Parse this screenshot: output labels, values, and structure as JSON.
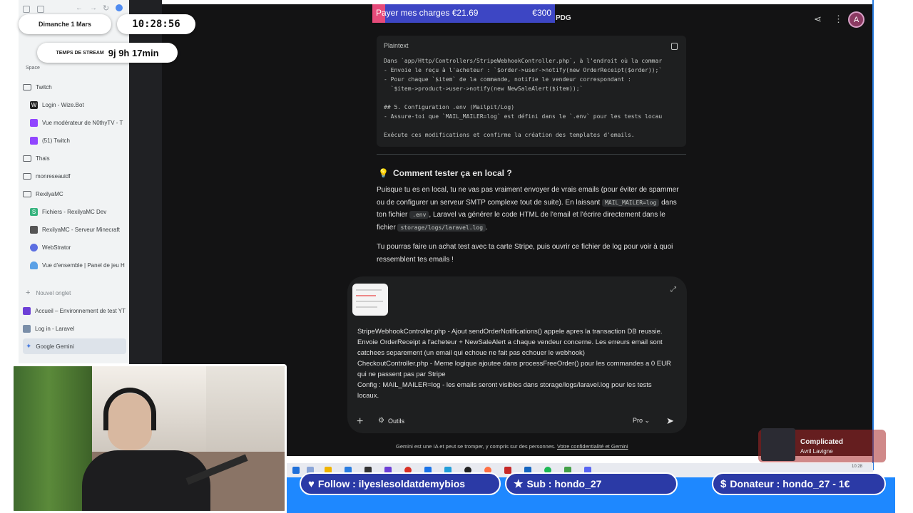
{
  "overlay": {
    "date": "Dimanche 1 Mars",
    "clock": "10:28:56",
    "stream_label": "TEMPS DE STREAM",
    "stream_time": "9j 9h 17min",
    "goal": {
      "label": "Payer mes charges €21.69",
      "target": "€300",
      "progress": 0.07
    },
    "follow": "Follow : ilyeslesoldatdemybios",
    "sub": "Sub : hondo_27",
    "donor": "Donateur : hondo_27 - 1€",
    "music": {
      "title": "Complicated",
      "artist": "Avril Lavigne"
    }
  },
  "sidebar": {
    "space_label": "Space",
    "items": [
      {
        "label": "Twitch",
        "icon": "folder-icon"
      },
      {
        "label": "Login - Wize.Bot",
        "icon": "wizebot-icon"
      },
      {
        "label": "Vue modérateur de N0thyTV - T",
        "icon": "twitch-icon"
      },
      {
        "label": "(51) Twitch",
        "icon": "twitch-icon"
      },
      {
        "label": "Thais",
        "icon": "folder-icon"
      },
      {
        "label": "monreseauidf",
        "icon": "folder-icon"
      },
      {
        "label": "RexilyaMC",
        "icon": "folder-icon"
      },
      {
        "label": "Fichiers - RexilyaMC Dev",
        "icon": "file-icon"
      },
      {
        "label": "RexilyaMC - Serveur Minecraft",
        "icon": "minecraft-icon"
      },
      {
        "label": "WebStrator",
        "icon": "webstrator-icon"
      },
      {
        "label": "Vue d'ensemble | Panel de jeu H",
        "icon": "cloud-icon"
      },
      {
        "label": "Nouvel onglet",
        "icon": "plus-icon"
      },
      {
        "label": "Accueil – Environnement de test YT",
        "icon": "page-icon"
      },
      {
        "label": "Log in - Laravel",
        "icon": "laravel-icon"
      },
      {
        "label": "Google Gemini",
        "icon": "gemini-icon"
      }
    ]
  },
  "gemini": {
    "header_fragment": "PDG",
    "code_lang": "Plaintext",
    "code_lines": [
      "Dans `app/Http/Controllers/StripeWebhookController.php`, à l'endroit où la commar",
      "- Envoie le reçu à l'acheteur : `$order->user->notify(new OrderReceipt($order));`",
      "- Pour chaque `$item` de la commande, notifie le vendeur correspondant :",
      "  `$item->product->user->notify(new NewSaleAlert($item));`",
      "",
      "## 5. Configuration .env (Mailpit/Log)",
      "- Assure-toi que `MAIL_MAILER=log` est défini dans le `.env` pour les tests locau",
      "",
      "Exécute ces modifications et confirme la création des templates d'emails."
    ],
    "heading": "Comment tester ça en local ?",
    "para1": {
      "t1": "Puisque tu es en local, tu ne vas pas vraiment envoyer de vrais emails (pour éviter de spammer ou de configurer un serveur SMTP complexe tout de suite). En laissant ",
      "c1": "MAIL_MAILER=log",
      "t2": " dans ton fichier ",
      "c2": ".env",
      "t3": ", Laravel va générer le code HTML de l'email et l'écrire directement dans le fichier ",
      "c3": "storage/logs/laravel.log",
      "t4": "."
    },
    "para2": "Tu pourras faire un achat test avec ta carte Stripe, puis ouvrir ce fichier de log pour voir à quoi ressemblent tes emails !",
    "input_lines": [
      "StripeWebhookController.php - Ajout sendOrderNotifications() appele apres la transaction DB reussie. Envoie OrderReceipt a l'acheteur + NewSaleAlert a chaque vendeur concerne. Les erreurs email sont catchees separement (un email qui echoue ne fait pas echouer le webhook)",
      "CheckoutController.php - Meme logique ajoutee dans processFreeOrder() pour les commandes a 0 EUR qui ne passent pas par Stripe",
      "Config : MAIL_MAILER=log - les emails seront visibles dans storage/logs/laravel.log pour les tests locaux."
    ],
    "tools_label": "Outils",
    "model_label": "Pro",
    "disclaimer": "Gemini est une IA et peut se tromper, y compris sur des personnes. ",
    "disclaimer_link": "Votre confidentialité et Gemini",
    "avatar_letter": "A"
  },
  "taskbar": {
    "time": "10:28"
  },
  "colors": {
    "accent": "#2b3aa6",
    "banner": "#1e88ff",
    "goal_fill": "#e64b7a",
    "goal_bg": "#3d46c4"
  }
}
